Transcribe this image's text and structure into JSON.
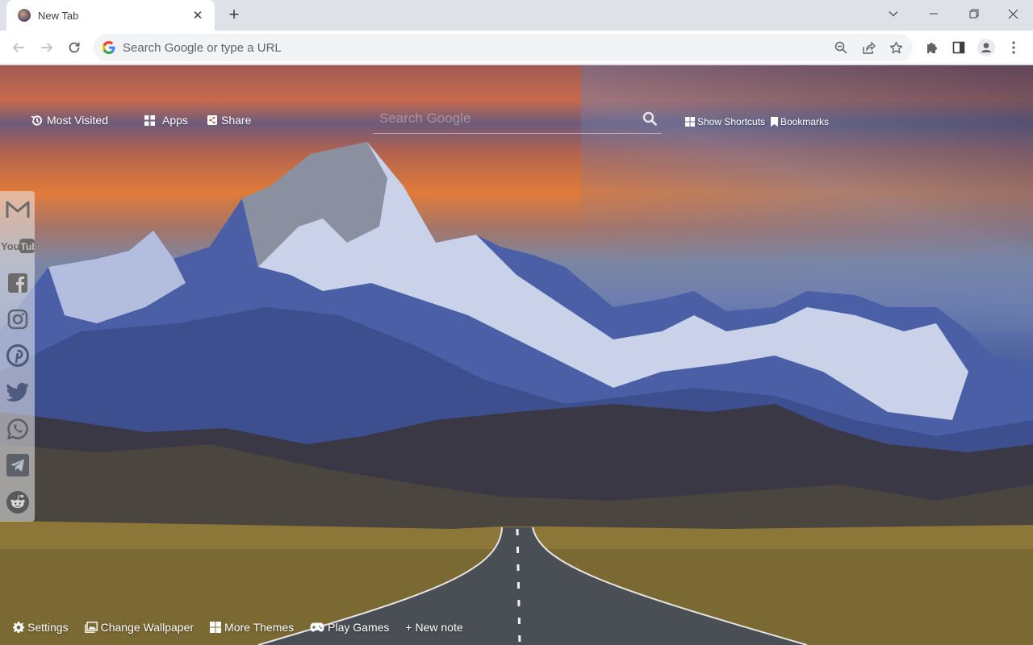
{
  "browser": {
    "tab": {
      "title": "New Tab",
      "close_icon": "close-icon",
      "favicon": "wallpaper-favicon"
    },
    "new_tab_label": "+",
    "window_controls": [
      "tab-search",
      "minimize",
      "restore",
      "close"
    ],
    "omnibox": {
      "placeholder": "Search Google or type a URL",
      "value": ""
    },
    "toolbar_icons": [
      "back-icon",
      "forward-icon",
      "reload-icon",
      "zoom-out-icon",
      "share-icon",
      "bookmark-star-icon",
      "extensions-icon",
      "side-panel-icon",
      "profile-icon",
      "menu-icon"
    ]
  },
  "newtab": {
    "top_links": {
      "most_visited": "Most Visited",
      "apps": "Apps",
      "share": "Share",
      "show_shortcuts": "Show Shortcuts",
      "bookmarks": "Bookmarks"
    },
    "search": {
      "placeholder": "Search Google",
      "value": ""
    },
    "social": [
      {
        "name": "gmail",
        "label": "M"
      },
      {
        "name": "youtube",
        "label": "YouTube"
      },
      {
        "name": "facebook",
        "label": "f"
      },
      {
        "name": "instagram",
        "label": ""
      },
      {
        "name": "pinterest",
        "label": "P"
      },
      {
        "name": "twitter",
        "label": ""
      },
      {
        "name": "whatsapp",
        "label": ""
      },
      {
        "name": "telegram",
        "label": ""
      },
      {
        "name": "reddit",
        "label": ""
      }
    ],
    "bottom": {
      "settings": "Settings",
      "change_wallpaper": "Change Wallpaper",
      "more_themes": "More Themes",
      "play_games": "Play Games",
      "new_note": "+ New note"
    },
    "colors": {
      "link_text": "#ffffff",
      "sidebar_icon": "#6b6b6b"
    }
  }
}
